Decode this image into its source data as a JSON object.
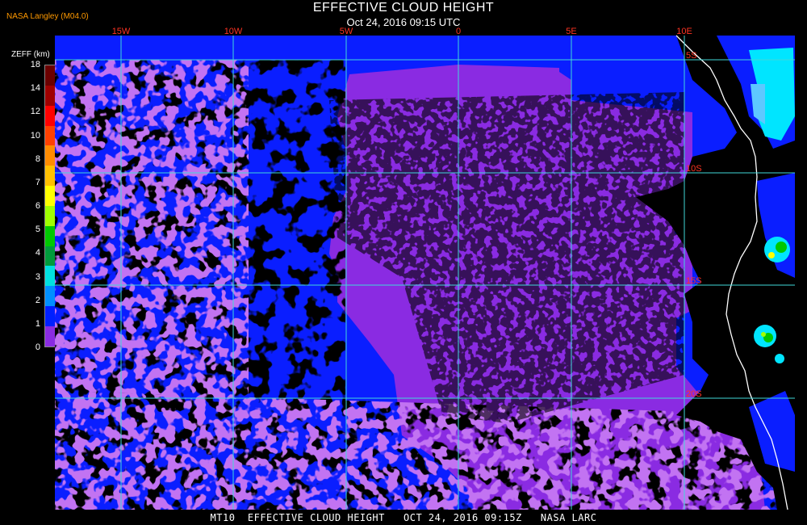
{
  "header": {
    "producer": "NASA Langley (M04.0)",
    "title": "EFFECTIVE CLOUD HEIGHT",
    "subtitle": "Oct 24, 2016 09:15 UTC"
  },
  "legend": {
    "unit": "ZEFF (km)",
    "ticks": [
      "18",
      "14",
      "12",
      "10",
      "8",
      "7",
      "6",
      "5",
      "4",
      "3",
      "2",
      "1",
      "0"
    ],
    "colors": [
      "#6b0000",
      "#a00000",
      "#ff0000",
      "#ff4000",
      "#ff8c00",
      "#ffc000",
      "#ffff00",
      "#a0ff00",
      "#00c800",
      "#009b3c",
      "#00e0e0",
      "#0090ff",
      "#0020ff",
      "#8a2be2"
    ]
  },
  "map": {
    "colors": {
      "ocean_clear": "#000000",
      "low_cloud": "#8a2be2",
      "mid_cloud": "#0a1eff",
      "high_cloud": "#00e5ff",
      "grid": "#40d8d8",
      "coast": "#ffffff"
    },
    "lon_labels": [
      "15W",
      "10W",
      "5W",
      "0",
      "5E",
      "10E"
    ],
    "lat_labels": [
      "5S",
      "10S",
      "15S",
      "20S"
    ]
  },
  "footer": {
    "text": "MT10  EFFECTIVE CLOUD HEIGHT   OCT 24, 2016 09:15Z   NASA LARC"
  }
}
